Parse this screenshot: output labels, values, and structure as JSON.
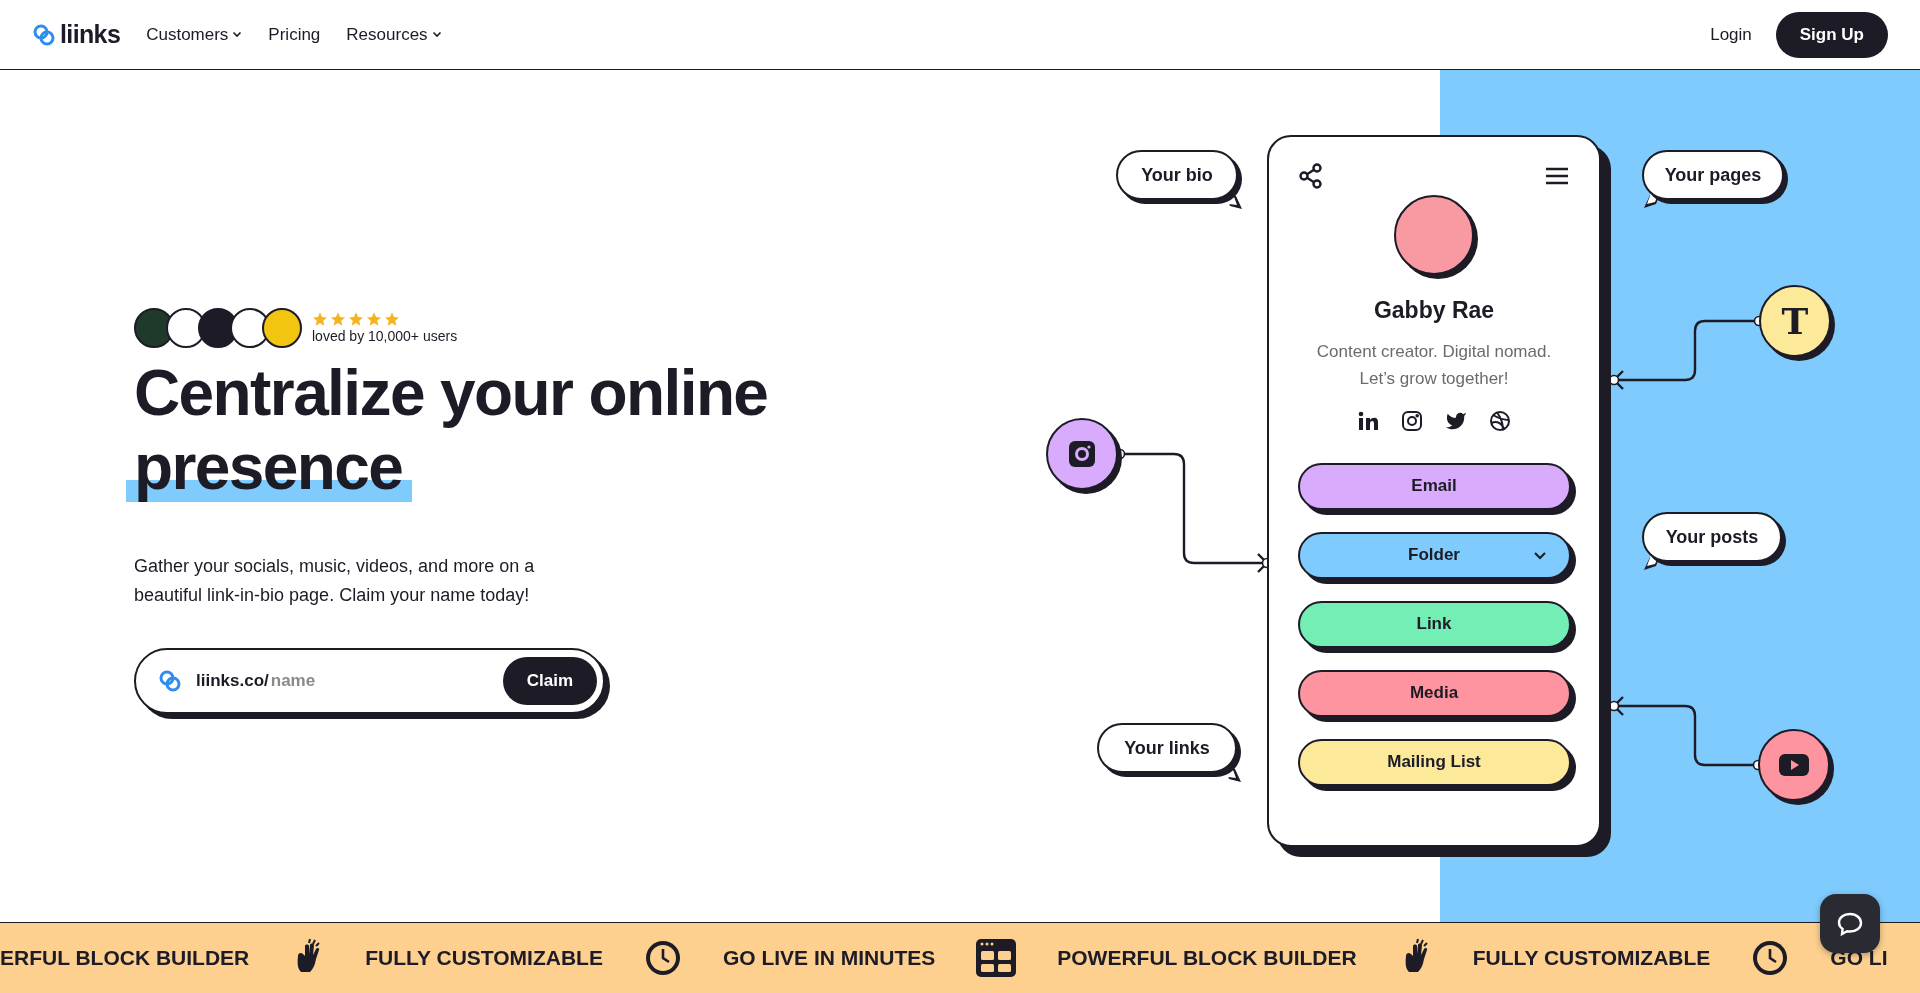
{
  "header": {
    "logo": "liinks",
    "nav": [
      {
        "label": "Customers",
        "has_menu": true
      },
      {
        "label": "Pricing",
        "has_menu": false
      },
      {
        "label": "Resources",
        "has_menu": true
      }
    ],
    "login": "Login",
    "signup": "Sign Up"
  },
  "hero": {
    "rating": {
      "stars": 5,
      "caption": "loved by 10,000+ users"
    },
    "headline": {
      "text": "Centralize your online ",
      "highlighted": "presence"
    },
    "description": "Gather your socials, music, videos, and more on a beautiful link-in-bio page. Claim your name today!",
    "claim": {
      "prefix": "liinks.co/",
      "placeholder": "name",
      "button": "Claim"
    }
  },
  "profile": {
    "name": "Gabby Rae",
    "bio": "Content creator. Digital nomad. Let’s grow together!",
    "blocks": [
      {
        "label": "Email",
        "kind": "link",
        "color": "#d8abfc"
      },
      {
        "label": "Folder",
        "kind": "folder",
        "color": "#7fcbfd"
      },
      {
        "label": "Link",
        "kind": "link",
        "color": "#73efb6"
      },
      {
        "label": "Media",
        "kind": "link",
        "color": "#fd949f"
      },
      {
        "label": "Mailing List",
        "kind": "link",
        "color": "#fde99a"
      }
    ]
  },
  "callouts": [
    {
      "label": "Your bio",
      "tail_right": true
    },
    {
      "label": "Your pages",
      "tail_right": false
    },
    {
      "label": "Your posts",
      "tail_right": false
    },
    {
      "label": "Your links",
      "tail_right": true
    }
  ],
  "feature_nodes": [
    {
      "kind": "instagram",
      "color": "#d8abfc"
    },
    {
      "kind": "text",
      "glyph": "T",
      "color": "#fde99a"
    },
    {
      "kind": "youtube",
      "color": "#fd949f"
    }
  ],
  "marquee": [
    {
      "kind": "text",
      "label": "ERFUL BLOCK BUILDER"
    },
    {
      "kind": "hand"
    },
    {
      "kind": "text",
      "label": "FULLY CUSTOMIZABLE"
    },
    {
      "kind": "clock"
    },
    {
      "kind": "text",
      "label": "GO LIVE IN MINUTES"
    },
    {
      "kind": "grid"
    },
    {
      "kind": "text",
      "label": "POWERFUL BLOCK BUILDER"
    },
    {
      "kind": "hand"
    },
    {
      "kind": "text",
      "label": "FULLY CUSTOMIZABLE"
    },
    {
      "kind": "clock"
    },
    {
      "kind": "text",
      "label": "GO LI"
    }
  ]
}
